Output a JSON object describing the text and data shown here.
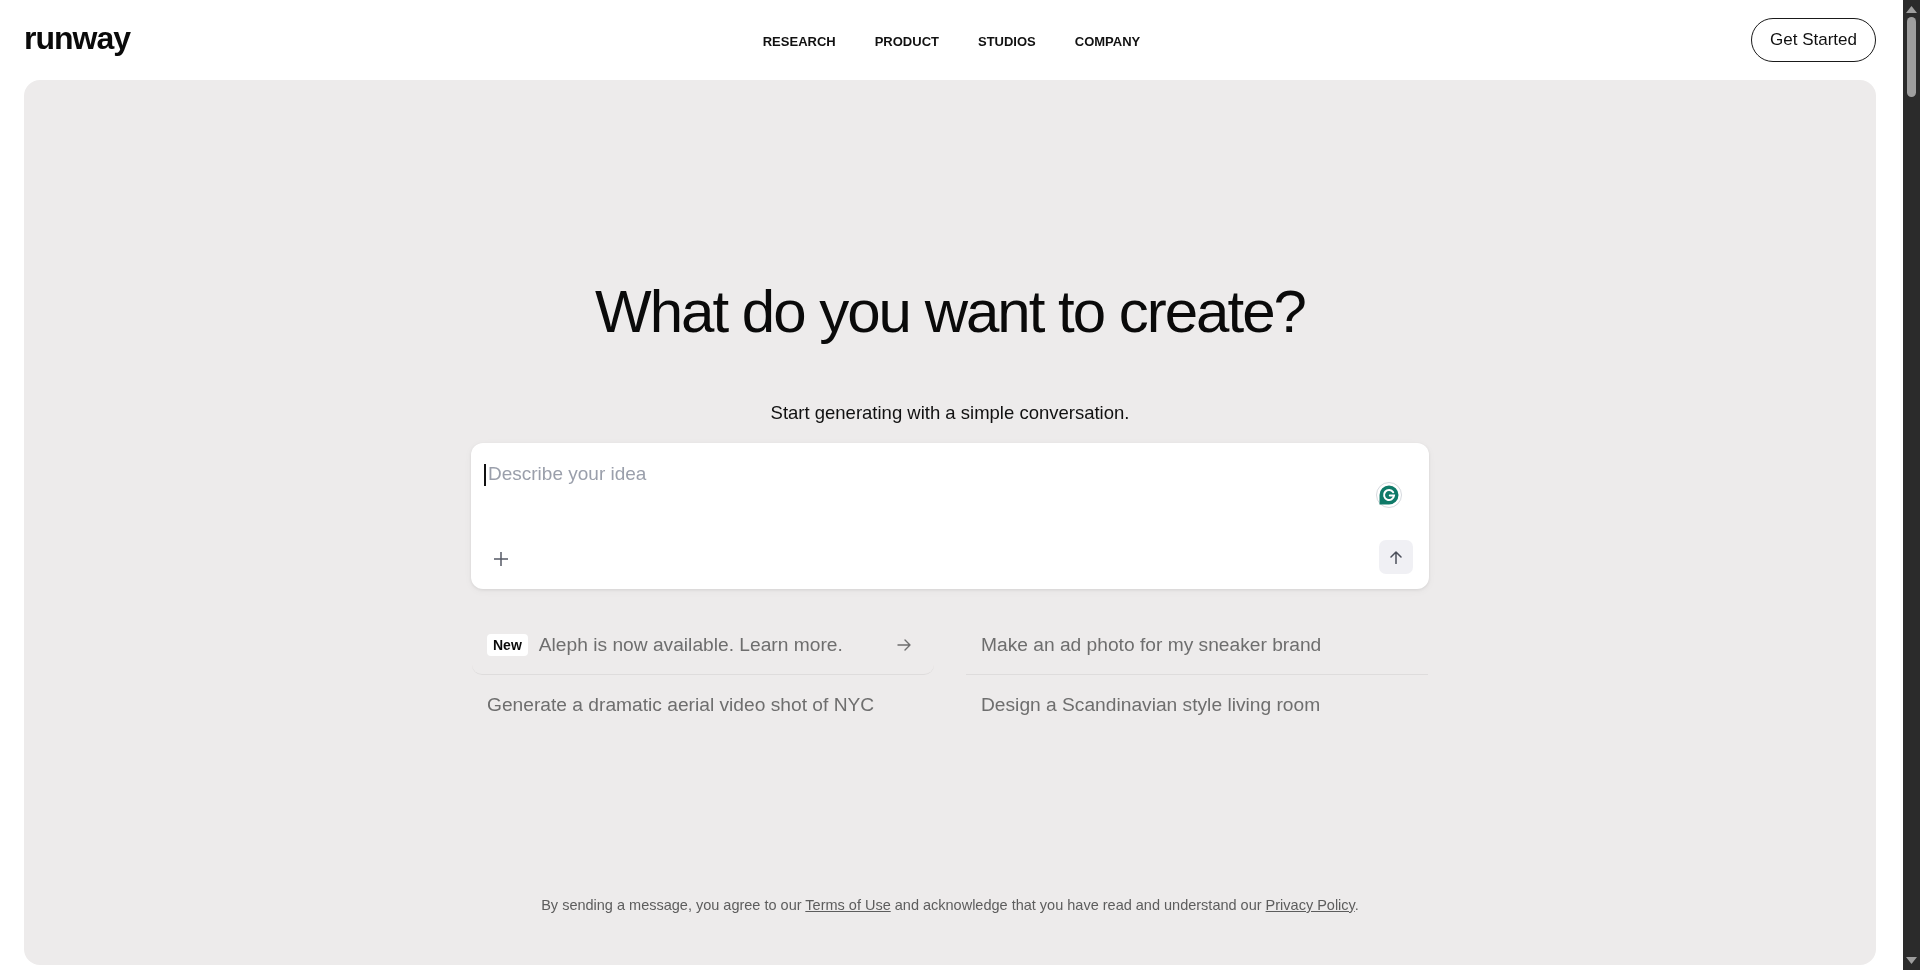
{
  "header": {
    "logo": "runway",
    "nav": [
      {
        "label": "RESEARCH"
      },
      {
        "label": "PRODUCT"
      },
      {
        "label": "STUDIOS"
      },
      {
        "label": "COMPANY"
      }
    ],
    "cta": "Get Started"
  },
  "hero": {
    "title": "What do you want to create?",
    "subtitle": "Start generating with a simple conversation.",
    "prompt": {
      "placeholder": "Describe your idea"
    },
    "suggestions": [
      {
        "kind": "announcement",
        "badge": "New",
        "text": "Aleph is now available. Learn more."
      },
      {
        "kind": "prompt",
        "text": "Make an ad photo for my sneaker brand"
      },
      {
        "kind": "prompt",
        "text": "Generate a dramatic aerial video shot of NYC"
      },
      {
        "kind": "prompt",
        "text": "Design a Scandinavian style living room"
      }
    ],
    "disclaimer": [
      {
        "kind": "text",
        "text": "By sending a message, you agree to our "
      },
      {
        "kind": "link",
        "text": "Terms of Use"
      },
      {
        "kind": "text",
        "text": " and acknowledge that you have read and understand our "
      },
      {
        "kind": "link",
        "text": "Privacy Policy"
      },
      {
        "kind": "text",
        "text": "."
      }
    ]
  }
}
